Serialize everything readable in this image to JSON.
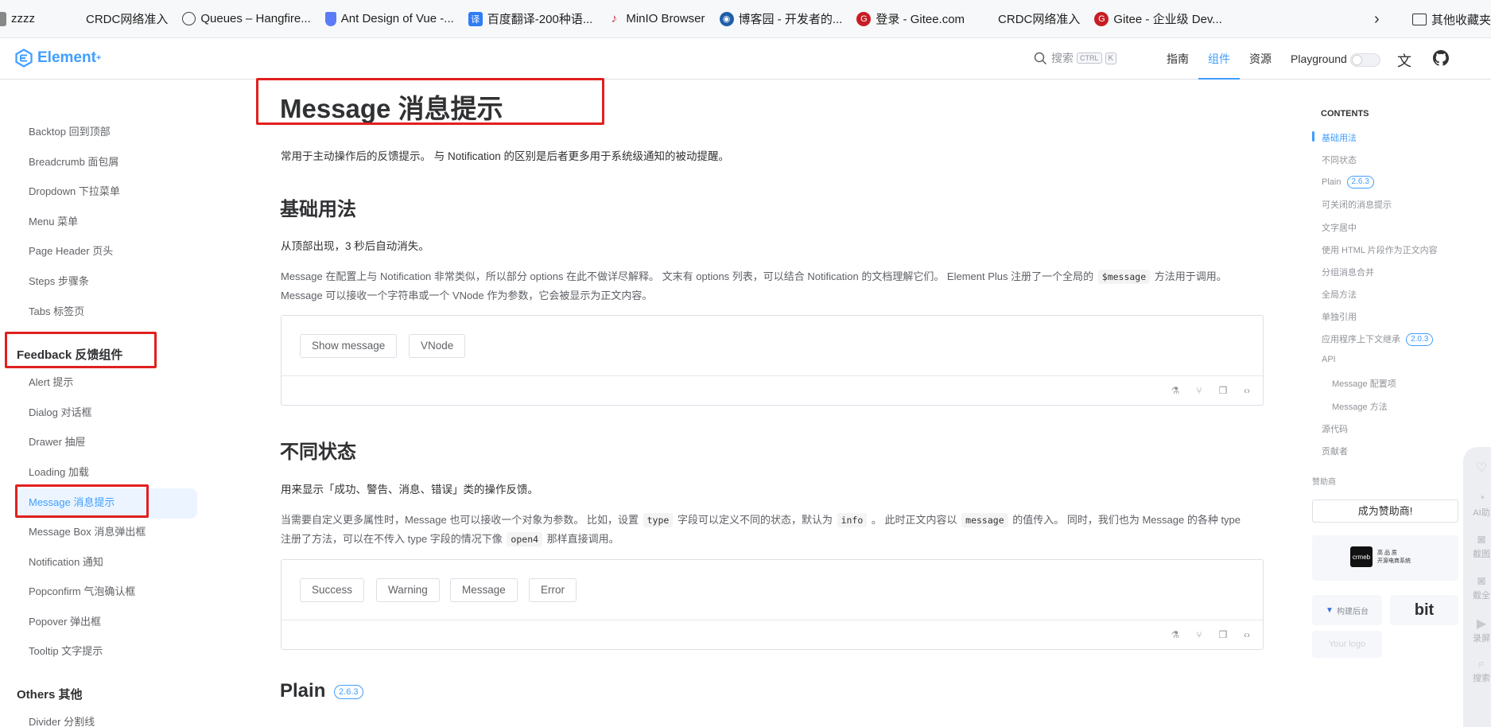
{
  "bookmarks": {
    "items": [
      {
        "label": "zzzz",
        "icon": "folder-icon"
      },
      {
        "label": "CRDC网络准入",
        "icon": "page-icon"
      },
      {
        "label": "Queues – Hangfire...",
        "icon": "globe-icon"
      },
      {
        "label": "Ant Design of Vue -...",
        "icon": "shield-icon"
      },
      {
        "label": "百度翻译-200种语...",
        "icon": "translate-icon"
      },
      {
        "label": "MinIO Browser",
        "icon": "minio-icon"
      },
      {
        "label": "博客园 - 开发者的...",
        "icon": "cnblogs-icon"
      },
      {
        "label": "登录 - Gitee.com",
        "icon": "gitee-icon"
      },
      {
        "label": "CRDC网络准入",
        "icon": "page-icon"
      },
      {
        "label": "Gitee - 企业级 Dev...",
        "icon": "gitee-icon"
      }
    ],
    "other": "其他收藏夹"
  },
  "nav": {
    "logo": "Element",
    "logo_sup": "+",
    "search_placeholder": "搜索",
    "kbd_ctrl": "CTRL",
    "kbd_k": "K",
    "links": [
      "指南",
      "组件",
      "资源",
      "Playground"
    ],
    "active_link": "组件"
  },
  "sidebar": {
    "top_items": [
      "Backtop 回到顶部",
      "Breadcrumb 面包屑",
      "Dropdown 下拉菜单",
      "Menu 菜单",
      "Page Header 页头",
      "Steps 步骤条",
      "Tabs 标签页"
    ],
    "feedback_group": "Feedback 反馈组件",
    "feedback_items": [
      "Alert 提示",
      "Dialog 对话框",
      "Drawer 抽屉",
      "Loading 加载",
      "Message 消息提示",
      "Message Box 消息弹出框",
      "Notification 通知",
      "Popconfirm 气泡确认框",
      "Popover 弹出框",
      "Tooltip 文字提示"
    ],
    "others_group": "Others 其他",
    "others_items": [
      "Divider 分割线"
    ]
  },
  "main": {
    "title": "Message 消息提示",
    "intro": "常用于主动操作后的反馈提示。 与 Notification 的区别是后者更多用于系统级通知的被动提醒。",
    "basic": {
      "heading": "基础用法",
      "desc": "从顶部出现，3 秒后自动消失。",
      "detail_1a": "Message 在配置上与 Notification 非常类似，所以部分 options 在此不做详尽解释。 文末有 options 列表，可以结合 Notification 的文档理解它们。 Element Plus 注册了一个全局的",
      "detail_code": "$message",
      "detail_1b": "方法用于调用。",
      "detail_2": "Message 可以接收一个字符串或一个 VNode 作为参数，它会被显示为正文内容。",
      "buttons": [
        "Show message",
        "VNode"
      ]
    },
    "types": {
      "heading": "不同状态",
      "desc": "用来显示「成功、警告、消息、错误」类的操作反馈。",
      "detail_a": "当需要自定义更多属性时，Message 也可以接收一个对象为参数。 比如，设置",
      "code_type": "type",
      "detail_b": "字段可以定义不同的状态，默认为",
      "code_info": "info",
      "detail_c": "。 此时正文内容以",
      "code_message": "message",
      "detail_d": "的值传入。 同时，我们也为 Message 的各种 type",
      "detail_2a": "注册了方法，可以在不传入 type 字段的情况下像",
      "code_open4": "open4",
      "detail_2b": "那样直接调用。",
      "buttons": [
        "Success",
        "Warning",
        "Message",
        "Error"
      ]
    },
    "plain": {
      "heading": "Plain",
      "badge": "2.6.3"
    }
  },
  "toc": {
    "title": "CONTENTS",
    "items": [
      "基础用法",
      "不同状态",
      "Plain",
      "可关闭的消息提示",
      "文字居中",
      "使用 HTML 片段作为正文内容",
      "分组消息合并",
      "全局方法",
      "单独引用",
      "应用程序上下文继承",
      "API",
      "Message 配置项",
      "Message 方法",
      "源代码",
      "贡献者"
    ],
    "plain_badge": "2.6.3",
    "context_badge": "2.0.3",
    "sponsor_label": "赞助商",
    "sponsor_button": "成为赞助商!",
    "crmeb_logo": "crmeb",
    "crmeb_title": "高 品 质",
    "crmeb_sub": "开源电商系统",
    "sponsor_2": "构建后台",
    "sponsor_3": "bit",
    "sponsor_4": "Your logo"
  },
  "floatbar": {
    "items": [
      "AI助",
      "截图",
      "截全",
      "录屏",
      "搜索"
    ]
  },
  "colors": {
    "accent": "#409eff",
    "highlight_box": "#e0201f"
  }
}
